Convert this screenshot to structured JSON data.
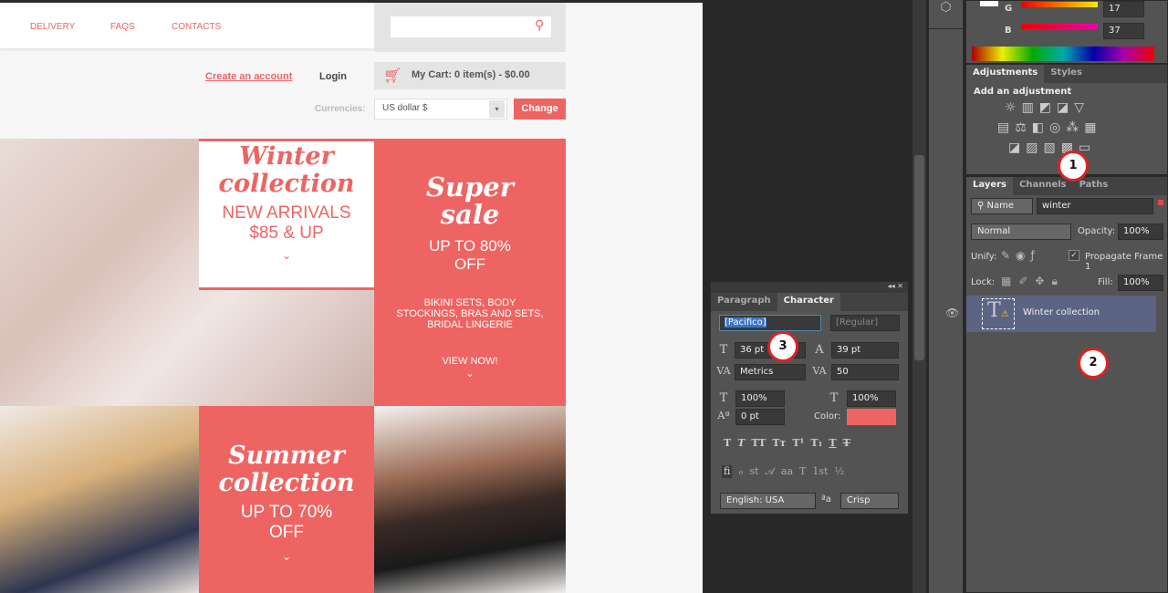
{
  "website": {
    "nav": [
      "DELIVERY",
      "FAQS",
      "CONTACTS"
    ],
    "search_placeholder": "",
    "create_account": "Create an account",
    "login": "Login",
    "cart": "My Cart: 0 item(s) - $0.00",
    "currencies_label": "Currencies:",
    "currency_value": "US dollar $",
    "change_button": "Change",
    "winter": {
      "title1": "Winter",
      "title2": "collection",
      "sub1": "NEW ARRIVALS",
      "sub2": "$85 & UP"
    },
    "supersale": {
      "title1": "Super",
      "title2": "sale",
      "sub1": "UP TO 80%",
      "sub2": "OFF",
      "desc1": "BIKINI SETS, BODY",
      "desc2": "STOCKINGS, BRAS AND SETS,",
      "desc3": "BRIDAL LINGERIE",
      "cta": "VIEW NOW!"
    },
    "summer": {
      "title1": "Summer",
      "title2": "collection",
      "sub1": "UP TO 70%",
      "sub2": "OFF"
    },
    "accent": "#ee6462"
  },
  "color_panel": {
    "g_label": "G",
    "g_value": "17",
    "b_label": "B",
    "b_value": "37"
  },
  "adjustments": {
    "tabs": [
      "Adjustments",
      "Styles"
    ],
    "heading": "Add an adjustment"
  },
  "layers": {
    "tabs": [
      "Layers",
      "Channels",
      "Paths"
    ],
    "filter_kind": "Name",
    "filter_value": "winter",
    "blend_mode": "Normal",
    "opacity_label": "Opacity:",
    "opacity": "100%",
    "unify_label": "Unify:",
    "propagate": "Propagate Frame 1",
    "lock_label": "Lock:",
    "fill_label": "Fill:",
    "fill": "100%",
    "items": [
      {
        "name": "Winter collection",
        "type": "text",
        "visible": true
      }
    ]
  },
  "character": {
    "tabs": [
      "Paragraph",
      "Character"
    ],
    "font_family": "[Pacifico]",
    "font_style": "[Regular]",
    "size": "36 pt",
    "leading": "39 pt",
    "kerning": "Metrics",
    "tracking": "50",
    "vscale": "100%",
    "hscale": "100%",
    "baseline": "0 pt",
    "color_label": "Color:",
    "color": "#ee6462",
    "type_buttons": [
      "T",
      "T",
      "TT",
      "Tт",
      "T¹",
      "T₁",
      "T",
      "T"
    ],
    "opentype_buttons": [
      "fi",
      "ℴ",
      "st",
      "𝒜",
      "aa",
      "T",
      "1st",
      "½"
    ],
    "language": "English: USA",
    "aa_label": "ªa",
    "antialias": "Crisp"
  },
  "callouts": [
    "1",
    "2",
    "3"
  ]
}
